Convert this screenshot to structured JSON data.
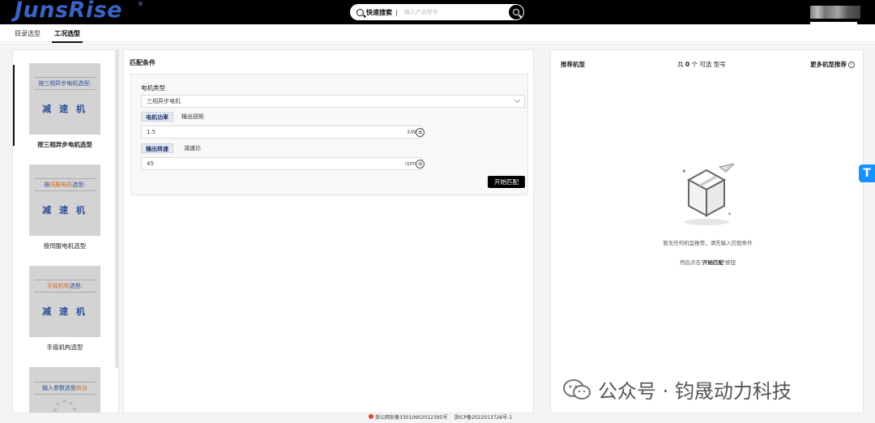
{
  "header": {
    "logo": "JunsRise",
    "logo_mark": "®",
    "search_label": "快速搜索",
    "search_separator": "|",
    "search_placeholder": "输入产品型号"
  },
  "tabs": [
    {
      "label": "目录选型",
      "active": false
    },
    {
      "label": "工况选型",
      "active": true
    }
  ],
  "left_panel": {
    "items": [
      {
        "image_top": "按三相异步电机选型:",
        "image_main": "减 速 机",
        "label": "按三相异步电机选型",
        "active": true
      },
      {
        "image_top": "按伺服电机选型:",
        "image_main": "减 速 机",
        "label": "按伺服电机选型",
        "active": false
      },
      {
        "image_top": "手摇机构选型:",
        "image_main": "减 速 机",
        "label": "手摇机构选型",
        "active": false
      },
      {
        "image_top": "输入参数选型转台",
        "image_main": "",
        "label": "",
        "active": false
      }
    ]
  },
  "match": {
    "title": "匹配条件",
    "motor_type_label": "电机类型",
    "motor_type_value": "三相异步电机",
    "power_tabs": [
      "电机功率",
      "输出扭矩"
    ],
    "power_value": "1.5",
    "power_unit": "kW",
    "speed_tabs": [
      "输出转速",
      "减速比"
    ],
    "speed_value": "45",
    "speed_unit": "rpm",
    "stepper_symbol": "±",
    "start_button": "开始匹配"
  },
  "recommend": {
    "title": "推荐机型",
    "count_prefix": "共",
    "count": "0",
    "count_suffix": "个 可选 型号",
    "more": "更多机型推荐",
    "empty_line1": "暂无任何机型推荐，请先输入匹配条件",
    "empty_line2_prefix": "然后点击",
    "empty_line2_action": "'开始匹配'",
    "empty_line2_suffix": "按钮"
  },
  "watermark": "公众号 · 钧晟动力科技",
  "float_button": "T",
  "footer": {
    "police": "浙公网安备33010602012395号",
    "icp": "浙ICP备2022013726号-1"
  },
  "colors": {
    "topbar": "#000000",
    "logo": "#3b63c4",
    "accent_orange": "#d2691e",
    "float_blue": "#1890ff"
  }
}
